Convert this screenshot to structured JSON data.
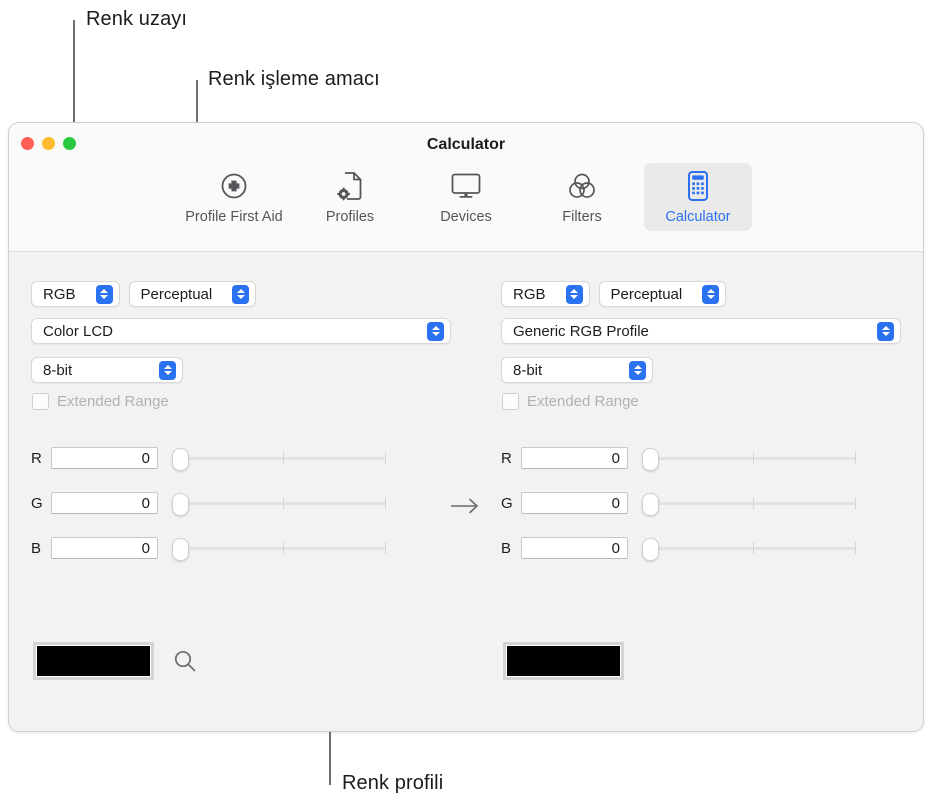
{
  "callouts": [
    {
      "id": "color-space",
      "label": "Renk uzayı"
    },
    {
      "id": "render-intent",
      "label": "Renk işleme amacı"
    },
    {
      "id": "color-profile",
      "label": "Renk profili"
    }
  ],
  "window": {
    "title": "Calculator",
    "traffic_lights": [
      {
        "name": "close",
        "color": "#ff5f57"
      },
      {
        "name": "minimize",
        "color": "#febc2e"
      },
      {
        "name": "zoom",
        "color": "#28c840"
      }
    ],
    "toolbar": {
      "items": [
        {
          "label": "Profile First Aid",
          "icon": "plus-circle-icon",
          "selected": false
        },
        {
          "label": "Profiles",
          "icon": "document-gear-icon",
          "selected": false
        },
        {
          "label": "Devices",
          "icon": "display-icon",
          "selected": false
        },
        {
          "label": "Filters",
          "icon": "venn-circles-icon",
          "selected": false
        },
        {
          "label": "Calculator",
          "icon": "calculator-icon",
          "selected": true
        }
      ],
      "selected_color": "#2b72f0",
      "label_color": "#55565a"
    }
  },
  "panels": {
    "left": {
      "color_space": "RGB",
      "rendering_intent": "Perceptual",
      "profile": "Color LCD",
      "bit_depth": "8-bit",
      "extended_range_label": "Extended Range",
      "extended_range_checked": false,
      "channels": [
        {
          "name": "R",
          "value": "0",
          "position_pct": 0
        },
        {
          "name": "G",
          "value": "0",
          "position_pct": 0
        },
        {
          "name": "B",
          "value": "0",
          "position_pct": 0
        }
      ],
      "swatch_color": "#000000",
      "has_picker": true,
      "picker_icon": "magnifier-icon"
    },
    "right": {
      "color_space": "RGB",
      "rendering_intent": "Perceptual",
      "profile": "Generic RGB Profile",
      "bit_depth": "8-bit",
      "extended_range_label": "Extended Range",
      "extended_range_checked": false,
      "channels": [
        {
          "name": "R",
          "value": "0",
          "position_pct": 0
        },
        {
          "name": "G",
          "value": "0",
          "position_pct": 0
        },
        {
          "name": "B",
          "value": "0",
          "position_pct": 0
        }
      ],
      "swatch_color": "#000000",
      "has_picker": false
    }
  },
  "conversion_arrow": "→"
}
